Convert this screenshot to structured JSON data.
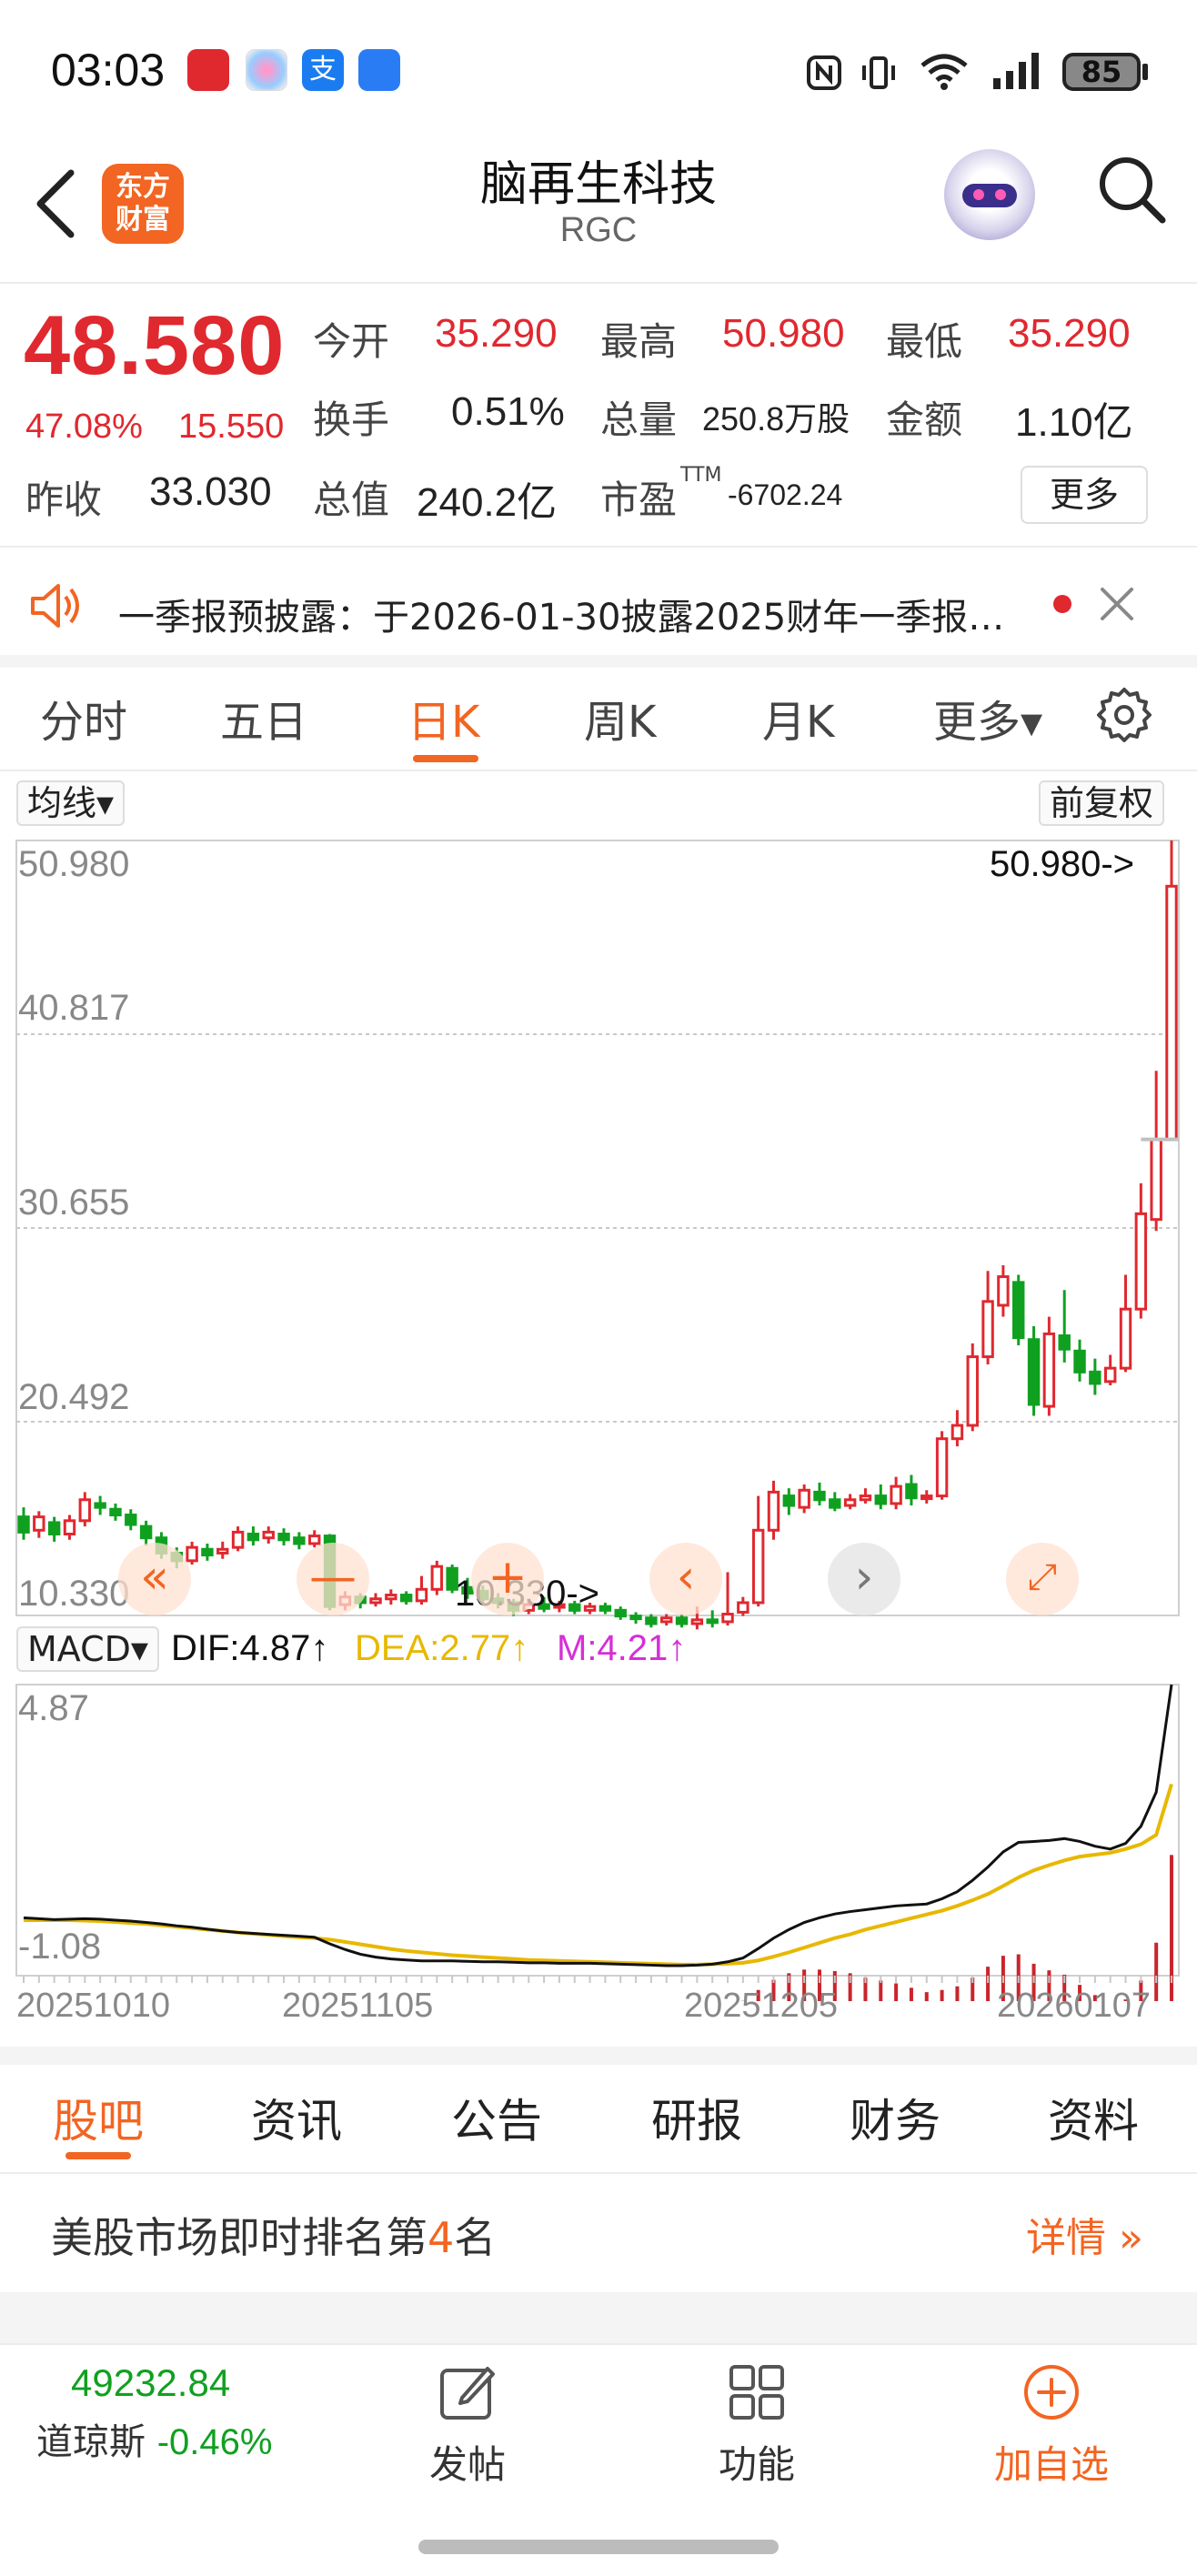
{
  "status_bar": {
    "time": "03:03",
    "battery": "85"
  },
  "header": {
    "title": "脑再生科技",
    "subtitle": "RGC",
    "logo_line1": "东方",
    "logo_line2": "财富"
  },
  "quote": {
    "price": "48.580",
    "change_pct": "47.08%",
    "change": "15.550",
    "prev_close_label": "昨收",
    "prev_close": "33.030",
    "open_label": "今开",
    "open": "35.290",
    "high_label": "最高",
    "high": "50.980",
    "low_label": "最低",
    "low": "35.290",
    "turnover_label": "换手",
    "turnover": "0.51%",
    "volume_label": "总量",
    "volume": "250.8万股",
    "amount_label": "金额",
    "amount": "1.10亿",
    "mcap_label": "总值",
    "mcap": "240.2亿",
    "pe_label": "市盈",
    "pe_sup": "TTM",
    "pe": "-6702.24",
    "more": "更多"
  },
  "notice": {
    "text": "一季报预披露：于2026-01-30披露2025财年一季报…"
  },
  "chart_tabs": [
    "分时",
    "五日",
    "日K",
    "周K",
    "月K",
    "更多▾"
  ],
  "chart_tabs_active": "日K",
  "chart_controls": {
    "ma_select": "均线▾",
    "adjust": "前复权",
    "macd_select": "MACD▾"
  },
  "kline": {
    "y_labels": [
      "50.980",
      "40.817",
      "30.655",
      "20.492",
      "10.330"
    ],
    "max_marker": "50.980->",
    "min_marker": "10.330->"
  },
  "macd": {
    "dif": "DIF:4.87↑",
    "dea": "DEA:2.77↑",
    "m": "M:4.21↑",
    "y_top": "4.87",
    "y_bottom": "-1.08",
    "colors": {
      "dif": "#111111",
      "dea": "#e8b800",
      "m": "#d62fd6"
    }
  },
  "dates": [
    "20251010",
    "20251105",
    "20251205",
    "20260107"
  ],
  "chart_data": {
    "type": "candlestick",
    "ylim": [
      10.33,
      50.98
    ],
    "y_ticks": [
      50.98,
      40.817,
      30.655,
      20.492,
      10.33
    ],
    "x_tick_labels": [
      "20251010",
      "20251105",
      "20251205",
      "20260107"
    ],
    "candles": [
      [
        15.5,
        14.7,
        16.0,
        14.3
      ],
      [
        14.8,
        15.5,
        15.8,
        14.4
      ],
      [
        15.2,
        14.6,
        15.5,
        14.2
      ],
      [
        14.6,
        15.3,
        15.6,
        14.3
      ],
      [
        15.3,
        16.4,
        16.8,
        15.0
      ],
      [
        16.2,
        16.0,
        16.6,
        15.6
      ],
      [
        15.9,
        15.6,
        16.2,
        15.3
      ],
      [
        15.6,
        15.1,
        15.9,
        14.8
      ],
      [
        15.0,
        14.4,
        15.3,
        14.0
      ],
      [
        14.4,
        13.6,
        14.7,
        13.3
      ],
      [
        13.6,
        13.2,
        13.9,
        12.8
      ],
      [
        13.2,
        13.9,
        14.2,
        13.0
      ],
      [
        13.8,
        13.5,
        14.1,
        13.2
      ],
      [
        13.6,
        13.8,
        14.2,
        13.3
      ],
      [
        13.9,
        14.7,
        15.0,
        13.7
      ],
      [
        14.6,
        14.3,
        15.0,
        14.0
      ],
      [
        14.4,
        14.7,
        15.0,
        14.1
      ],
      [
        14.6,
        14.3,
        14.9,
        14.0
      ],
      [
        14.4,
        14.1,
        14.7,
        13.8
      ],
      [
        14.1,
        14.5,
        14.8,
        13.9
      ],
      [
        14.5,
        10.8,
        14.6,
        10.6
      ],
      [
        10.9,
        11.3,
        11.6,
        10.6
      ],
      [
        11.3,
        11.0,
        11.5,
        10.7
      ],
      [
        11.0,
        11.2,
        11.5,
        10.8
      ],
      [
        11.2,
        11.4,
        11.7,
        10.9
      ],
      [
        11.4,
        11.1,
        11.6,
        10.9
      ],
      [
        11.1,
        11.7,
        12.4,
        10.9
      ],
      [
        11.7,
        12.9,
        13.2,
        11.4
      ],
      [
        12.8,
        11.7,
        13.0,
        11.5
      ],
      [
        11.8,
        11.5,
        12.3,
        11.2
      ],
      [
        11.6,
        11.2,
        11.9,
        10.9
      ],
      [
        11.2,
        11.0,
        11.5,
        10.7
      ],
      [
        11.0,
        10.6,
        11.2,
        10.3
      ],
      [
        10.6,
        10.9,
        11.2,
        10.4
      ],
      [
        10.9,
        10.7,
        11.3,
        10.5
      ],
      [
        10.8,
        10.9,
        11.1,
        10.5
      ],
      [
        10.9,
        10.6,
        11.1,
        10.4
      ],
      [
        10.6,
        10.8,
        11.0,
        10.4
      ],
      [
        10.8,
        10.6,
        11.0,
        10.4
      ],
      [
        10.6,
        10.3,
        10.8,
        10.1
      ],
      [
        10.3,
        10.2,
        10.5,
        9.9
      ],
      [
        10.2,
        9.9,
        10.4,
        9.7
      ],
      [
        10.0,
        10.2,
        10.4,
        9.8
      ],
      [
        10.2,
        9.9,
        10.4,
        9.7
      ],
      [
        9.9,
        10.1,
        10.8,
        9.6
      ],
      [
        10.1,
        10.0,
        10.6,
        9.7
      ],
      [
        10.0,
        10.4,
        12.6,
        9.8
      ],
      [
        10.5,
        11.0,
        11.3,
        10.3
      ],
      [
        11.0,
        14.8,
        16.6,
        10.8
      ],
      [
        14.8,
        16.8,
        17.4,
        14.3
      ],
      [
        16.6,
        16.1,
        17.0,
        15.6
      ],
      [
        16.0,
        16.9,
        17.2,
        15.7
      ],
      [
        16.8,
        16.4,
        17.3,
        16.1
      ],
      [
        16.4,
        16.0,
        16.8,
        15.8
      ],
      [
        16.1,
        16.4,
        16.7,
        15.9
      ],
      [
        16.4,
        16.6,
        17.0,
        16.2
      ],
      [
        16.6,
        16.2,
        17.2,
        15.9
      ],
      [
        16.2,
        17.1,
        17.6,
        15.9
      ],
      [
        17.2,
        16.5,
        17.7,
        16.1
      ],
      [
        16.5,
        16.6,
        16.9,
        16.2
      ],
      [
        16.6,
        19.6,
        20.0,
        16.4
      ],
      [
        19.6,
        20.3,
        21.1,
        19.2
      ],
      [
        20.3,
        23.9,
        24.6,
        20.0
      ],
      [
        23.9,
        26.8,
        28.4,
        23.5
      ],
      [
        26.6,
        28.1,
        28.7,
        26.0
      ],
      [
        27.8,
        24.9,
        28.2,
        24.5
      ],
      [
        24.8,
        21.4,
        25.5,
        20.8
      ],
      [
        21.3,
        25.1,
        26.0,
        20.8
      ],
      [
        25.0,
        24.3,
        27.4,
        23.6
      ],
      [
        24.2,
        23.1,
        24.8,
        22.6
      ],
      [
        23.1,
        22.5,
        23.8,
        21.9
      ],
      [
        22.6,
        23.3,
        24.0,
        22.4
      ],
      [
        23.3,
        26.4,
        28.2,
        23.1
      ],
      [
        26.4,
        31.4,
        33.0,
        25.9
      ],
      [
        31.1,
        35.3,
        38.9,
        30.5
      ],
      [
        35.29,
        48.58,
        50.98,
        35.29
      ]
    ],
    "macd_ylim": [
      -1.08,
      4.87
    ],
    "dif": [
      -0.05,
      -0.07,
      -0.09,
      -0.08,
      -0.07,
      -0.08,
      -0.1,
      -0.12,
      -0.15,
      -0.18,
      -0.22,
      -0.25,
      -0.29,
      -0.33,
      -0.36,
      -0.38,
      -0.4,
      -0.42,
      -0.44,
      -0.46,
      -0.6,
      -0.72,
      -0.82,
      -0.88,
      -0.92,
      -0.94,
      -0.96,
      -0.96,
      -0.96,
      -0.97,
      -0.98,
      -0.98,
      -0.99,
      -1.0,
      -1.0,
      -1.01,
      -1.01,
      -1.01,
      -1.02,
      -1.03,
      -1.04,
      -1.05,
      -1.06,
      -1.06,
      -1.05,
      -1.03,
      -0.98,
      -0.9,
      -0.7,
      -0.48,
      -0.3,
      -0.15,
      -0.05,
      0.03,
      0.08,
      0.12,
      0.16,
      0.2,
      0.22,
      0.24,
      0.35,
      0.5,
      0.74,
      1.02,
      1.34,
      1.54,
      1.56,
      1.58,
      1.62,
      1.56,
      1.46,
      1.4,
      1.52,
      1.88,
      2.6,
      4.87
    ],
    "dea": [
      -0.1,
      -0.1,
      -0.1,
      -0.1,
      -0.11,
      -0.12,
      -0.14,
      -0.16,
      -0.18,
      -0.21,
      -0.24,
      -0.27,
      -0.3,
      -0.33,
      -0.36,
      -0.39,
      -0.41,
      -0.44,
      -0.46,
      -0.48,
      -0.51,
      -0.56,
      -0.61,
      -0.66,
      -0.71,
      -0.75,
      -0.78,
      -0.81,
      -0.84,
      -0.86,
      -0.88,
      -0.9,
      -0.92,
      -0.94,
      -0.95,
      -0.96,
      -0.97,
      -0.98,
      -0.99,
      -1.0,
      -1.01,
      -1.02,
      -1.03,
      -1.04,
      -1.04,
      -1.03,
      -1.02,
      -1.0,
      -0.95,
      -0.87,
      -0.78,
      -0.68,
      -0.58,
      -0.48,
      -0.4,
      -0.3,
      -0.22,
      -0.14,
      -0.06,
      0.02,
      0.1,
      0.2,
      0.32,
      0.45,
      0.62,
      0.8,
      0.95,
      1.06,
      1.16,
      1.24,
      1.28,
      1.32,
      1.4,
      1.5,
      1.7,
      2.77
    ],
    "macd_hist": [
      0.1,
      0.06,
      0.02,
      0.04,
      0.08,
      0.08,
      0.08,
      0.08,
      0.06,
      0.06,
      0.04,
      0.04,
      0.02,
      0.0,
      0.0,
      0.02,
      0.02,
      0.04,
      0.04,
      0.04,
      -0.18,
      -0.32,
      -0.42,
      -0.44,
      -0.42,
      -0.38,
      -0.36,
      -0.3,
      -0.24,
      -0.22,
      -0.2,
      -0.16,
      -0.14,
      -0.12,
      -0.1,
      -0.1,
      -0.08,
      -0.06,
      -0.06,
      -0.06,
      -0.06,
      -0.06,
      -0.06,
      -0.04,
      -0.02,
      0.0,
      0.08,
      0.2,
      0.5,
      0.78,
      0.96,
      1.06,
      1.06,
      1.02,
      0.96,
      0.84,
      0.76,
      0.68,
      0.56,
      0.44,
      0.5,
      0.6,
      0.84,
      1.14,
      1.44,
      1.48,
      1.22,
      1.04,
      0.92,
      0.64,
      0.36,
      0.16,
      0.24,
      0.76,
      1.8,
      4.21
    ]
  },
  "news_tabs": [
    "股吧",
    "资讯",
    "公告",
    "研报",
    "财务",
    "资料"
  ],
  "news_tabs_active": "股吧",
  "rank": {
    "text_pre": "美股市场即时排名第",
    "rank_num": "4",
    "text_post": "名",
    "link": "详情 »"
  },
  "bottom_nav": {
    "index_value": "49232.84",
    "index_name": "道琼斯",
    "index_change": "-0.46%",
    "post": "发帖",
    "func": "功能",
    "add": "加自选"
  },
  "colors": {
    "up": "#e0282f",
    "down": "#10a020",
    "accent": "#f26522"
  }
}
